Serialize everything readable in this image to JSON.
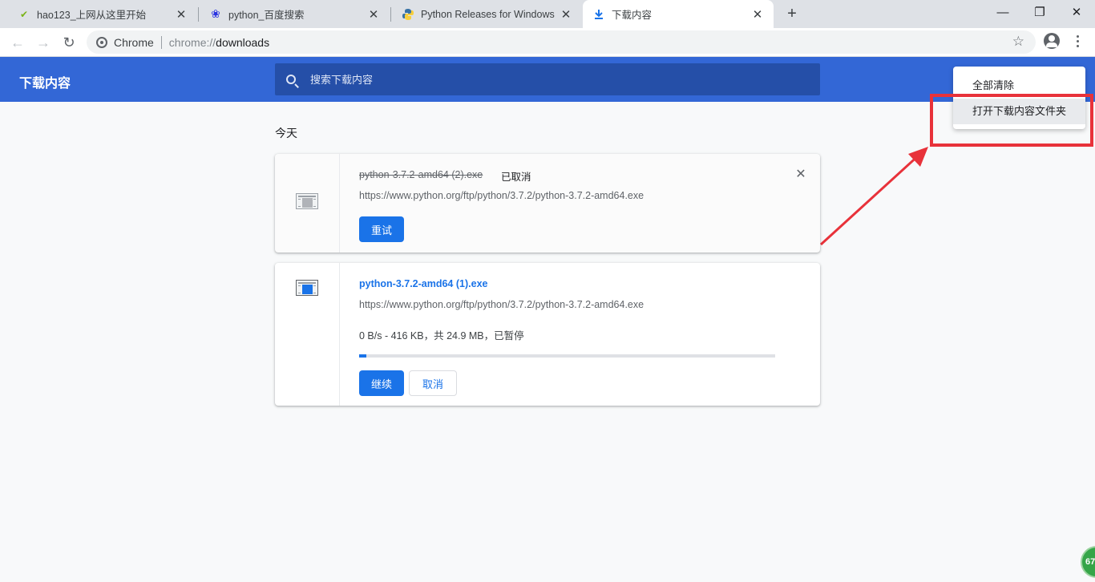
{
  "tabs": [
    {
      "title": "hao123_上网从这里开始",
      "icon": "hao123-icon"
    },
    {
      "title": "python_百度搜索",
      "icon": "baidu-paw-icon"
    },
    {
      "title": "Python Releases for Windows",
      "icon": "python-icon"
    },
    {
      "title": "下载内容",
      "icon": "download-icon",
      "active": true
    }
  ],
  "window_controls": {
    "minimize": "—",
    "restore": "❐",
    "close": "✕"
  },
  "toolbar": {
    "site_label": "Chrome",
    "url_scheme": "chrome://",
    "url_path": "downloads"
  },
  "page": {
    "title": "下载内容",
    "search_placeholder": "搜索下载内容",
    "section_date": "今天"
  },
  "menu": {
    "items": [
      "全部清除",
      "打开下载内容文件夹"
    ]
  },
  "downloads": [
    {
      "file_name": "python-3.7.2-amd64 (2).exe",
      "tag": "已取消",
      "url": "https://www.python.org/ftp/python/3.7.2/python-3.7.2-amd64.exe",
      "primary_action": "重试",
      "state": "cancelled"
    },
    {
      "file_name": "python-3.7.2-amd64 (1).exe",
      "url": "https://www.python.org/ftp/python/3.7.2/python-3.7.2-amd64.exe",
      "status": "0 B/s - 416 KB，共 24.9 MB，已暂停",
      "progress_fraction": 0.0167,
      "primary_action": "继续",
      "secondary_action": "取消",
      "state": "paused"
    }
  ],
  "corner_badge": "67",
  "colors": {
    "header_bg": "#3367d6",
    "search_bg": "#254fa8",
    "accent": "#1a73e8",
    "annotation_red": "#e8323a"
  }
}
